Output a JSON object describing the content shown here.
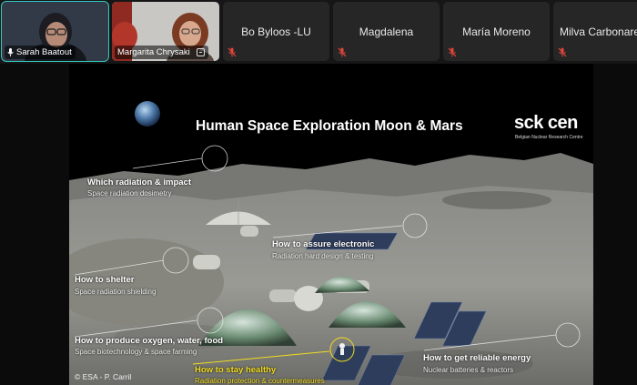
{
  "participants": [
    {
      "id": "sarah",
      "name": "Sarah Baatout",
      "has_video": true,
      "active": true
    },
    {
      "id": "margarita",
      "name": "Margarita Chrysaki",
      "has_video": true,
      "active": false
    },
    {
      "id": "bo",
      "name": "Bo Byloos -LU",
      "has_video": false,
      "muted": true
    },
    {
      "id": "magdalena",
      "name": "Magdalena",
      "has_video": false,
      "muted": true
    },
    {
      "id": "maria",
      "name": "María Moreno",
      "has_video": false,
      "muted": true
    },
    {
      "id": "milva",
      "name": "Milva Carbonare",
      "has_video": false,
      "muted": true
    }
  ],
  "slide": {
    "title": "Human Space Exploration Moon & Mars",
    "logo": {
      "text": "sck cen",
      "subtitle": "Belgian Nuclear Research Centre"
    },
    "callouts": [
      {
        "id": "radiation",
        "title": "Which radiation & impact",
        "subtitle": "Space radiation dosimetry",
        "highlight": false
      },
      {
        "id": "electronic",
        "title": "How to assure electronic",
        "subtitle": "Radiation hard design & testing",
        "highlight": false
      },
      {
        "id": "shelter",
        "title": "How to shelter",
        "subtitle": "Space radiation shielding",
        "highlight": false
      },
      {
        "id": "oxygen",
        "title": "How to produce oxygen, water, food",
        "subtitle": "Space biotechnology & space farming",
        "highlight": false
      },
      {
        "id": "healthy",
        "title": "How to stay healthy",
        "subtitle": "Radiation protection & countermeasures",
        "highlight": true
      },
      {
        "id": "energy",
        "title": "How to get reliable energy",
        "subtitle": "Nuclear batteries & reactors",
        "highlight": false
      }
    ],
    "credit": "© ESA - P. Carril"
  },
  "colors": {
    "active_speaker": "#33c9c2",
    "highlight": "#f3dd1e",
    "mute": "#e0463a"
  }
}
